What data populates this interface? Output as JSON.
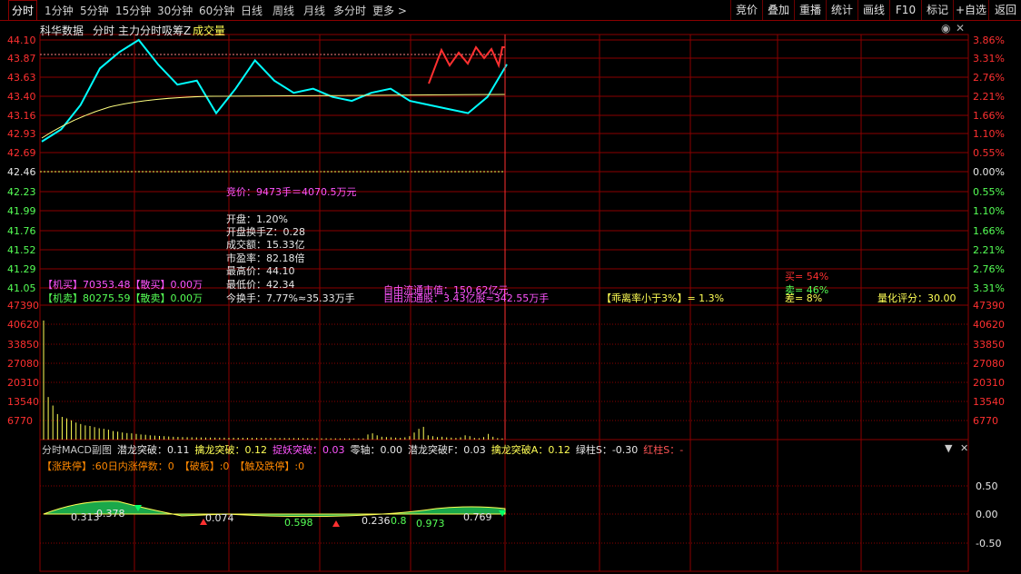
{
  "tabs": [
    "分时",
    "1分钟",
    "5分钟",
    "15分钟",
    "30分钟",
    "60分钟",
    "日线",
    "周线",
    "月线",
    "多分时",
    "更多 >"
  ],
  "right_tabs": [
    "竞价",
    "叠加",
    "重播",
    "统计",
    "画线",
    "F10",
    "标记",
    "+自选",
    "返回"
  ],
  "subheader": {
    "name": "科华数据",
    "mode": "分时",
    "indicator": "主力分时吸筹Z",
    "extra": "成交量"
  },
  "price_axis_left": [
    "44.10",
    "43.87",
    "43.63",
    "43.40",
    "43.16",
    "42.93",
    "42.69",
    "42.46",
    "42.23",
    "41.99",
    "41.76",
    "41.52",
    "41.29",
    "41.05"
  ],
  "pct_axis_right": [
    "3.86%",
    "3.31%",
    "2.76%",
    "2.21%",
    "1.66%",
    "1.10%",
    "0.55%",
    "0.00%",
    "0.55%",
    "1.10%",
    "1.66%",
    "2.21%",
    "2.76%",
    "3.31%"
  ],
  "volume_axis": [
    "47390",
    "40620",
    "33850",
    "27080",
    "20310",
    "13540",
    "6770"
  ],
  "macd_axis": [
    "0.50",
    "0.00",
    "-0.50"
  ],
  "info": {
    "auction": "竞价：9473手＝4070.5万元",
    "open": "开盘：1.20%",
    "open_turnover": "开盘换手Z：0.28",
    "amount": "成交额：15.33亿",
    "pe": "市盈率：82.18倍",
    "high": "最高价：44.10",
    "low": "最低价：42.34",
    "turnover": "今换手：7.77%≈35.33万手",
    "float_cap": "自由流通市值：150.62亿元",
    "float_shares": "自由流通股：3.43亿股≈342.55万手",
    "deviation": "【乖离率小于3%】= 1.3%",
    "inst_buy": "【机买】70353.48【散买】0.00万",
    "inst_sell": "【机卖】80275.59【散卖】0.00万",
    "buy_pct": "买= 54%",
    "sell_pct": "卖= 46%",
    "diff_pct": "差= 8%",
    "score": "量化评分：30.00"
  },
  "macd_header": [
    {
      "text": "分时MACD副图",
      "color": "#c8c8c8"
    },
    {
      "text": "潜龙突破：0.11",
      "color": "#e8e8e8"
    },
    {
      "text": "擒龙突破：0.12",
      "color": "#ffff55"
    },
    {
      "text": "捉妖突破：0.03",
      "color": "#ff55ff"
    },
    {
      "text": "零轴：0.00",
      "color": "#e8e8e8"
    },
    {
      "text": "潜龙突破F：0.03",
      "color": "#e8e8e8"
    },
    {
      "text": "擒龙突破A：0.12",
      "color": "#ffff55"
    },
    {
      "text": "绿柱S：-0.30",
      "color": "#e8e8e8"
    },
    {
      "text": "红柱S：-",
      "color": "#ff5555"
    }
  ],
  "limit_line": [
    {
      "text": "【涨跌停】:60日内涨停数：0",
      "color": "#ff8800"
    },
    {
      "text": "【破板】:0",
      "color": "#ff8800"
    },
    {
      "text": "【触及跌停】:0",
      "color": "#ff8800"
    }
  ],
  "macd_labels": [
    "0.313",
    "0.378",
    "0.074",
    "0.598",
    "0.236",
    "0.8",
    "0.973",
    "0.769"
  ],
  "colors": {
    "up": "#ff3030",
    "down": "#00ffff",
    "avg": "#ffff80",
    "grid": "#8b0000"
  },
  "price_series": {
    "base": 42.46,
    "x": [
      0,
      10,
      20,
      30,
      40,
      50,
      60,
      70,
      80,
      90,
      100,
      110,
      120,
      130,
      140,
      150,
      160,
      170,
      180,
      190,
      200,
      210,
      220,
      230,
      240
    ],
    "y": [
      42.85,
      43.0,
      43.3,
      43.75,
      43.95,
      44.1,
      43.8,
      43.55,
      43.6,
      43.2,
      43.5,
      43.85,
      43.6,
      43.45,
      43.5,
      43.4,
      43.35,
      43.45,
      43.5,
      43.35,
      43.3,
      43.25,
      43.2,
      43.4,
      43.8
    ]
  },
  "volume_series": [
    42000,
    15000,
    12000,
    9000,
    8000,
    7500,
    6800,
    6000,
    5500,
    5000,
    4800,
    4400,
    4000,
    3800,
    3500,
    3000,
    2800,
    2500,
    2300,
    2200,
    2000,
    1800,
    1700,
    1500,
    1400,
    1300,
    1200,
    1100,
    1000,
    950,
    900,
    850,
    800,
    780,
    760,
    740,
    720,
    700,
    690,
    680,
    660,
    650,
    640,
    630,
    620,
    610,
    600,
    590,
    580,
    570,
    560,
    550,
    540,
    530,
    520,
    510,
    500,
    490,
    480,
    470,
    460,
    450,
    440,
    430,
    420,
    410,
    400,
    400,
    400,
    400,
    1800,
    2200,
    1500,
    1000,
    900,
    800,
    700,
    600,
    800,
    1200,
    2500,
    3800,
    4500,
    1500,
    1200,
    900,
    1000,
    800,
    700,
    600,
    800,
    1500,
    1200,
    600,
    500,
    900,
    2000,
    1000,
    500,
    400
  ]
}
